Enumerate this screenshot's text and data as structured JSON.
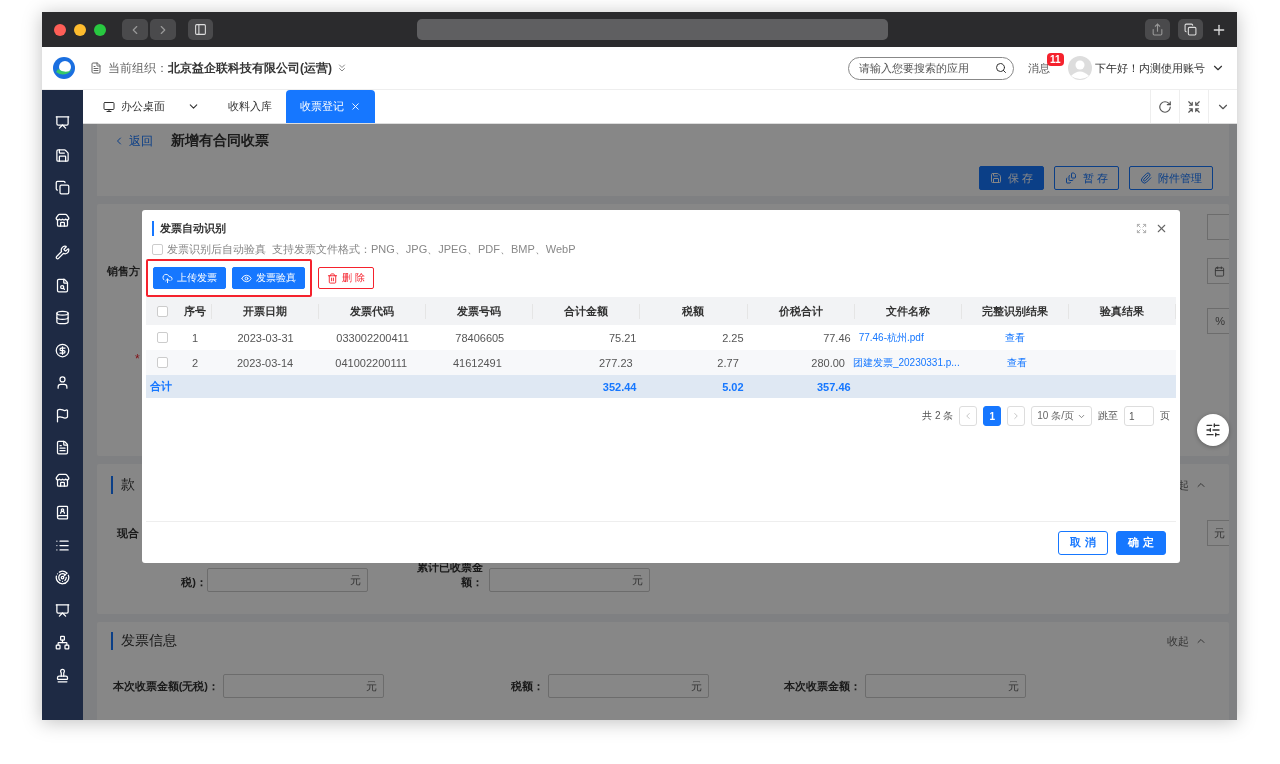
{
  "header": {
    "org_label": "当前组织：",
    "org_name": "北京益企联科技有限公司(运营)",
    "search_placeholder": "请输入您要搜索的应用",
    "messages_label": "消息",
    "messages_badge": "11",
    "greeting": "下午好！内测使用账号"
  },
  "tabs": [
    {
      "label": "办公桌面",
      "kind": "home",
      "selected": false
    },
    {
      "label": "收料入库",
      "kind": "page",
      "selected": false
    },
    {
      "label": "收票登记",
      "kind": "page",
      "selected": true
    }
  ],
  "page": {
    "back": "返回",
    "title": "新增有合同收票",
    "buttons": [
      {
        "label": "保 存",
        "kind": "primary"
      },
      {
        "label": "暂 存",
        "kind": "draft"
      },
      {
        "label": "附件管理",
        "kind": "attach"
      }
    ],
    "seller_label": "销售方",
    "percent_unit": "%",
    "required_mark": "*",
    "payment": {
      "title": "款",
      "collapse": "起",
      "current_label": "现合",
      "current_unit": "元",
      "acc_label": "税)：",
      "acc_unit": "元",
      "acc_invoice_label": "累计已收票金额：",
      "acc_invoice_unit": "元"
    },
    "invoice": {
      "title": "发票信息",
      "collapse": "收起",
      "fields": [
        {
          "label": "本次收票金额(无税)：",
          "unit": "元"
        },
        {
          "label": "税额：",
          "unit": "元"
        },
        {
          "label": "本次收票金额：",
          "unit": "元"
        }
      ]
    }
  },
  "modal": {
    "title": "发票自动识别",
    "auto_verify": {
      "label": "发票识别后自动验真",
      "checked": false
    },
    "formats": "支持发票文件格式：PNG、JPG、JPEG、PDF、BMP、WebP",
    "actions": [
      {
        "label": "上传发票",
        "kind": "upload",
        "highlighted": true
      },
      {
        "label": "发票验真",
        "kind": "verify",
        "highlighted": true
      },
      {
        "label": "删 除",
        "kind": "delete",
        "highlighted": false
      }
    ],
    "table": {
      "all_checked": false,
      "columns": [
        "序号",
        "开票日期",
        "发票代码",
        "发票号码",
        "合计金额",
        "税额",
        "价税合计",
        "文件名称",
        "完整识别结果",
        "验真结果"
      ],
      "rows": [
        {
          "checked": false,
          "cells": [
            "1",
            "2023-03-31",
            "033002200411",
            "78406605",
            "75.21",
            "2.25",
            "77.46",
            "77.46-杭州.pdf",
            "查看",
            ""
          ]
        },
        {
          "checked": false,
          "cells": [
            "2",
            "2023-03-14",
            "041002200111",
            "41612491",
            "277.23",
            "2.77",
            "280.00",
            "团建发票_20230331.p...",
            "查看",
            ""
          ]
        }
      ],
      "total": {
        "label": "合计",
        "amount": "352.44",
        "tax": "5.02",
        "sum": "357.46"
      }
    },
    "pagination": {
      "total": "共 2 条",
      "pages": [
        {
          "label": "1",
          "selected": true
        }
      ],
      "page_size": "10 条/页",
      "jump_label": "跳至",
      "jump_value": "1",
      "page_unit": "页"
    },
    "footer": {
      "cancel": "取 消",
      "ok": "确 定"
    }
  }
}
